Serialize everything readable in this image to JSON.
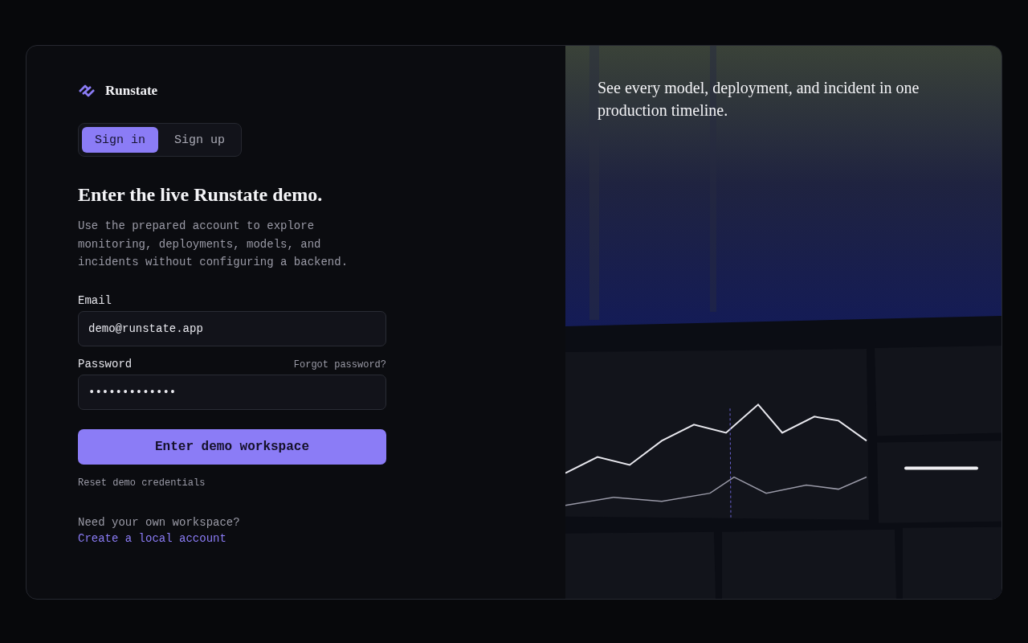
{
  "brand": {
    "name": "Runstate"
  },
  "tabs": [
    {
      "label": "Sign in",
      "selected": true
    },
    {
      "label": "Sign up",
      "selected": false
    }
  ],
  "heading": "Enter the live Runstate demo.",
  "description": "Use the prepared account to explore monitoring, deployments, models, and incidents without configuring a backend.",
  "email": {
    "label": "Email",
    "value": "demo@runstate.app"
  },
  "password": {
    "label": "Password",
    "value": "•••••••••••••",
    "link": "Forgot password?"
  },
  "submit": "Enter demo workspace",
  "reset_link": "Reset demo credentials",
  "footer": {
    "text": "Need your own workspace?",
    "link": "Create a local account"
  },
  "hero": {
    "caption": "See every model, deployment, and incident in one production timeline.",
    "kind": "picture"
  }
}
